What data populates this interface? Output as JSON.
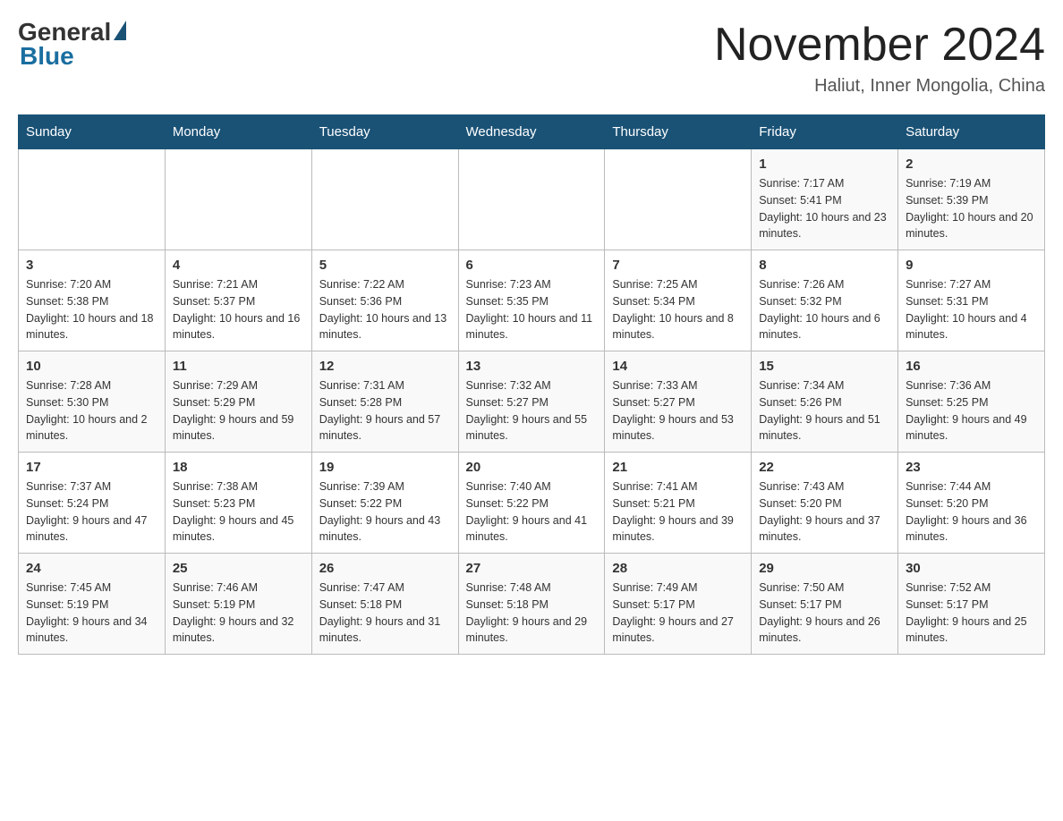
{
  "header": {
    "logo_general": "General",
    "logo_blue": "Blue",
    "month_title": "November 2024",
    "location": "Haliut, Inner Mongolia, China"
  },
  "days_of_week": [
    "Sunday",
    "Monday",
    "Tuesday",
    "Wednesday",
    "Thursday",
    "Friday",
    "Saturday"
  ],
  "weeks": [
    [
      {
        "day": "",
        "info": ""
      },
      {
        "day": "",
        "info": ""
      },
      {
        "day": "",
        "info": ""
      },
      {
        "day": "",
        "info": ""
      },
      {
        "day": "",
        "info": ""
      },
      {
        "day": "1",
        "info": "Sunrise: 7:17 AM\nSunset: 5:41 PM\nDaylight: 10 hours and 23 minutes."
      },
      {
        "day": "2",
        "info": "Sunrise: 7:19 AM\nSunset: 5:39 PM\nDaylight: 10 hours and 20 minutes."
      }
    ],
    [
      {
        "day": "3",
        "info": "Sunrise: 7:20 AM\nSunset: 5:38 PM\nDaylight: 10 hours and 18 minutes."
      },
      {
        "day": "4",
        "info": "Sunrise: 7:21 AM\nSunset: 5:37 PM\nDaylight: 10 hours and 16 minutes."
      },
      {
        "day": "5",
        "info": "Sunrise: 7:22 AM\nSunset: 5:36 PM\nDaylight: 10 hours and 13 minutes."
      },
      {
        "day": "6",
        "info": "Sunrise: 7:23 AM\nSunset: 5:35 PM\nDaylight: 10 hours and 11 minutes."
      },
      {
        "day": "7",
        "info": "Sunrise: 7:25 AM\nSunset: 5:34 PM\nDaylight: 10 hours and 8 minutes."
      },
      {
        "day": "8",
        "info": "Sunrise: 7:26 AM\nSunset: 5:32 PM\nDaylight: 10 hours and 6 minutes."
      },
      {
        "day": "9",
        "info": "Sunrise: 7:27 AM\nSunset: 5:31 PM\nDaylight: 10 hours and 4 minutes."
      }
    ],
    [
      {
        "day": "10",
        "info": "Sunrise: 7:28 AM\nSunset: 5:30 PM\nDaylight: 10 hours and 2 minutes."
      },
      {
        "day": "11",
        "info": "Sunrise: 7:29 AM\nSunset: 5:29 PM\nDaylight: 9 hours and 59 minutes."
      },
      {
        "day": "12",
        "info": "Sunrise: 7:31 AM\nSunset: 5:28 PM\nDaylight: 9 hours and 57 minutes."
      },
      {
        "day": "13",
        "info": "Sunrise: 7:32 AM\nSunset: 5:27 PM\nDaylight: 9 hours and 55 minutes."
      },
      {
        "day": "14",
        "info": "Sunrise: 7:33 AM\nSunset: 5:27 PM\nDaylight: 9 hours and 53 minutes."
      },
      {
        "day": "15",
        "info": "Sunrise: 7:34 AM\nSunset: 5:26 PM\nDaylight: 9 hours and 51 minutes."
      },
      {
        "day": "16",
        "info": "Sunrise: 7:36 AM\nSunset: 5:25 PM\nDaylight: 9 hours and 49 minutes."
      }
    ],
    [
      {
        "day": "17",
        "info": "Sunrise: 7:37 AM\nSunset: 5:24 PM\nDaylight: 9 hours and 47 minutes."
      },
      {
        "day": "18",
        "info": "Sunrise: 7:38 AM\nSunset: 5:23 PM\nDaylight: 9 hours and 45 minutes."
      },
      {
        "day": "19",
        "info": "Sunrise: 7:39 AM\nSunset: 5:22 PM\nDaylight: 9 hours and 43 minutes."
      },
      {
        "day": "20",
        "info": "Sunrise: 7:40 AM\nSunset: 5:22 PM\nDaylight: 9 hours and 41 minutes."
      },
      {
        "day": "21",
        "info": "Sunrise: 7:41 AM\nSunset: 5:21 PM\nDaylight: 9 hours and 39 minutes."
      },
      {
        "day": "22",
        "info": "Sunrise: 7:43 AM\nSunset: 5:20 PM\nDaylight: 9 hours and 37 minutes."
      },
      {
        "day": "23",
        "info": "Sunrise: 7:44 AM\nSunset: 5:20 PM\nDaylight: 9 hours and 36 minutes."
      }
    ],
    [
      {
        "day": "24",
        "info": "Sunrise: 7:45 AM\nSunset: 5:19 PM\nDaylight: 9 hours and 34 minutes."
      },
      {
        "day": "25",
        "info": "Sunrise: 7:46 AM\nSunset: 5:19 PM\nDaylight: 9 hours and 32 minutes."
      },
      {
        "day": "26",
        "info": "Sunrise: 7:47 AM\nSunset: 5:18 PM\nDaylight: 9 hours and 31 minutes."
      },
      {
        "day": "27",
        "info": "Sunrise: 7:48 AM\nSunset: 5:18 PM\nDaylight: 9 hours and 29 minutes."
      },
      {
        "day": "28",
        "info": "Sunrise: 7:49 AM\nSunset: 5:17 PM\nDaylight: 9 hours and 27 minutes."
      },
      {
        "day": "29",
        "info": "Sunrise: 7:50 AM\nSunset: 5:17 PM\nDaylight: 9 hours and 26 minutes."
      },
      {
        "day": "30",
        "info": "Sunrise: 7:52 AM\nSunset: 5:17 PM\nDaylight: 9 hours and 25 minutes."
      }
    ]
  ]
}
